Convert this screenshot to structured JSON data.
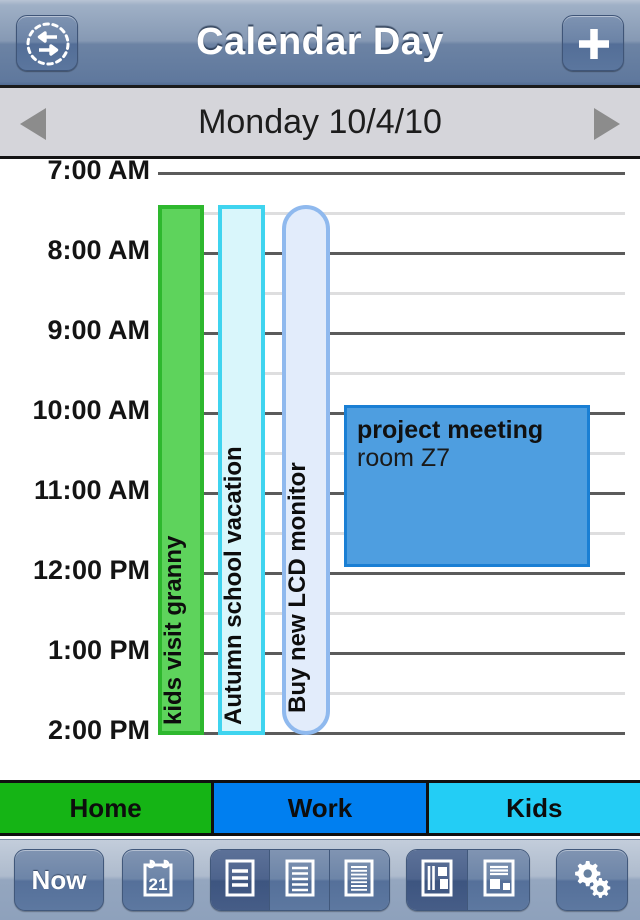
{
  "navbar": {
    "title": "Calendar Day",
    "left_button": {
      "icon": "sync-exchange-icon",
      "label": ""
    },
    "right_button": {
      "icon": "plus-icon",
      "label": "+"
    }
  },
  "datebar": {
    "label": "Monday  10/4/10",
    "prev_icon": "left-triangle-icon",
    "next_icon": "right-triangle-icon"
  },
  "grid": {
    "hours": [
      "7:00 AM",
      "8:00 AM",
      "9:00 AM",
      "10:00 AM",
      "11:00 AM",
      "12:00 PM",
      "1:00 PM",
      "2:00 PM"
    ],
    "start_hour_label": "7:00 AM",
    "end_hour_label": "2:00 PM"
  },
  "events": [
    {
      "title": "kids visit granny",
      "subtitle": "",
      "category": "Kids",
      "style": "all-day-column",
      "fill": "#5ed35c",
      "border": "#2eb82e",
      "start": "7:30 AM",
      "end": "2:00 PM"
    },
    {
      "title": "Autumn school vacation",
      "subtitle": "",
      "category": "Kids",
      "style": "all-day-column",
      "fill": "#d9f6fb",
      "border": "#3fd4ef",
      "start": "7:30 AM",
      "end": "2:00 PM"
    },
    {
      "title": "Buy new LCD monitor",
      "subtitle": "",
      "category": "Work",
      "style": "todo-column",
      "fill": "#e2ecfb",
      "border": "#8fb9ee",
      "start": "7:30 AM",
      "end": "2:00 PM"
    },
    {
      "title": "project meeting",
      "subtitle": "room Z7",
      "category": "Work",
      "style": "timed-block",
      "fill": "#4e9ee0",
      "border": "#1a7fd4",
      "start": "10:00 AM",
      "end": "12:00 PM"
    }
  ],
  "categories": [
    {
      "label": "Home",
      "color": "#15b415"
    },
    {
      "label": "Work",
      "color": "#007ff0"
    },
    {
      "label": "Kids",
      "color": "#23cdf5"
    }
  ],
  "toolbar": {
    "now_label": "Now",
    "date_picker_icon": "calendar-21-icon",
    "date_picker_day": "21",
    "zoom_group": [
      {
        "icon": "rows-3-icon",
        "selected": true
      },
      {
        "icon": "rows-5-icon",
        "selected": false
      },
      {
        "icon": "rows-8-icon",
        "selected": false
      }
    ],
    "layout_group": [
      {
        "icon": "layout-columns-icon",
        "selected": true
      },
      {
        "icon": "layout-rows-icon",
        "selected": false
      }
    ],
    "settings_icon": "gears-icon"
  }
}
